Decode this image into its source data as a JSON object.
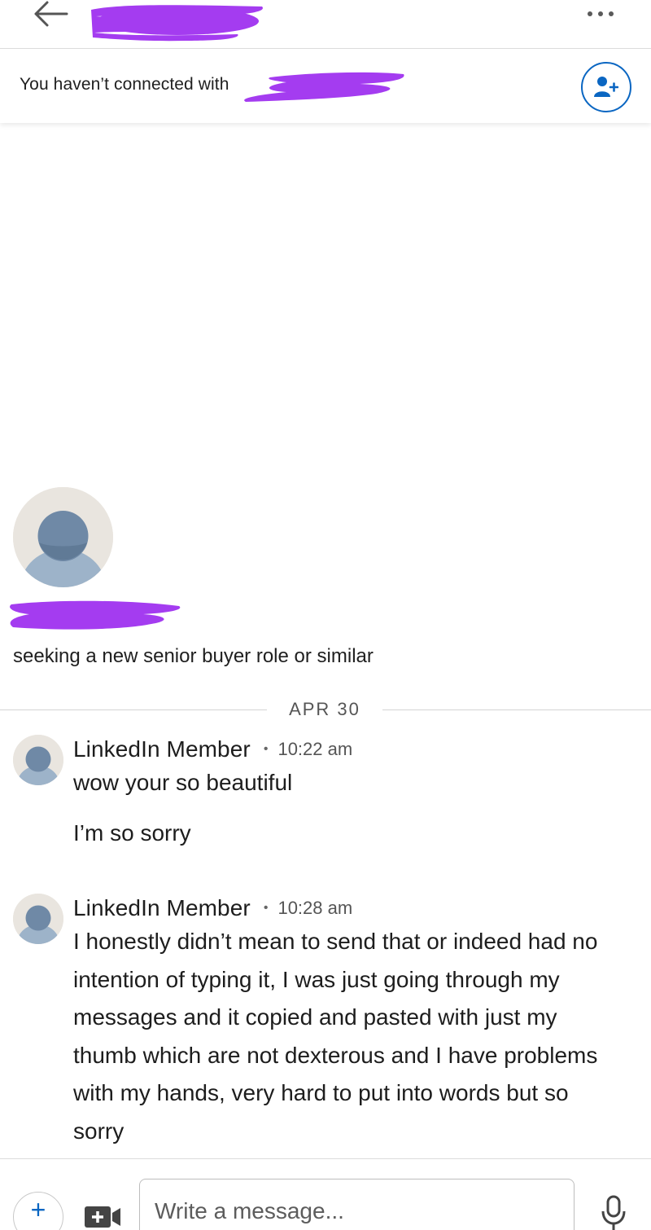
{
  "header": {
    "back_icon": "arrow-left-icon",
    "more_icon": "more-horizontal-icon",
    "redaction_color": "#a43cf0"
  },
  "connection_banner": {
    "text": "You haven’t connected with",
    "connect_icon": "add-person-icon",
    "accent_color": "#0a66c2"
  },
  "profile": {
    "avatar_icon": "default-avatar-icon",
    "headline": "seeking a new senior buyer role or similar"
  },
  "date_divider": {
    "label": "APR 30"
  },
  "messages": [
    {
      "sender": "LinkedIn Member",
      "time": "10:22 am",
      "paragraphs": [
        "wow your so beautiful",
        "I’m so sorry"
      ]
    },
    {
      "sender": "LinkedIn Member",
      "time": "10:28 am",
      "paragraphs": [
        "I honestly didn’t mean to send that or indeed had no intention of typing it, I was just going through my messages and it copied and pasted with just my thumb which are not dexterous and I have problems with my hands, very hard to put into words but so sorry"
      ]
    }
  ],
  "composer": {
    "placeholder": "Write a message...",
    "add_icon": "plus-icon",
    "add_label": "+",
    "video_icon": "video-camera-icon",
    "mic_icon": "microphone-icon"
  }
}
